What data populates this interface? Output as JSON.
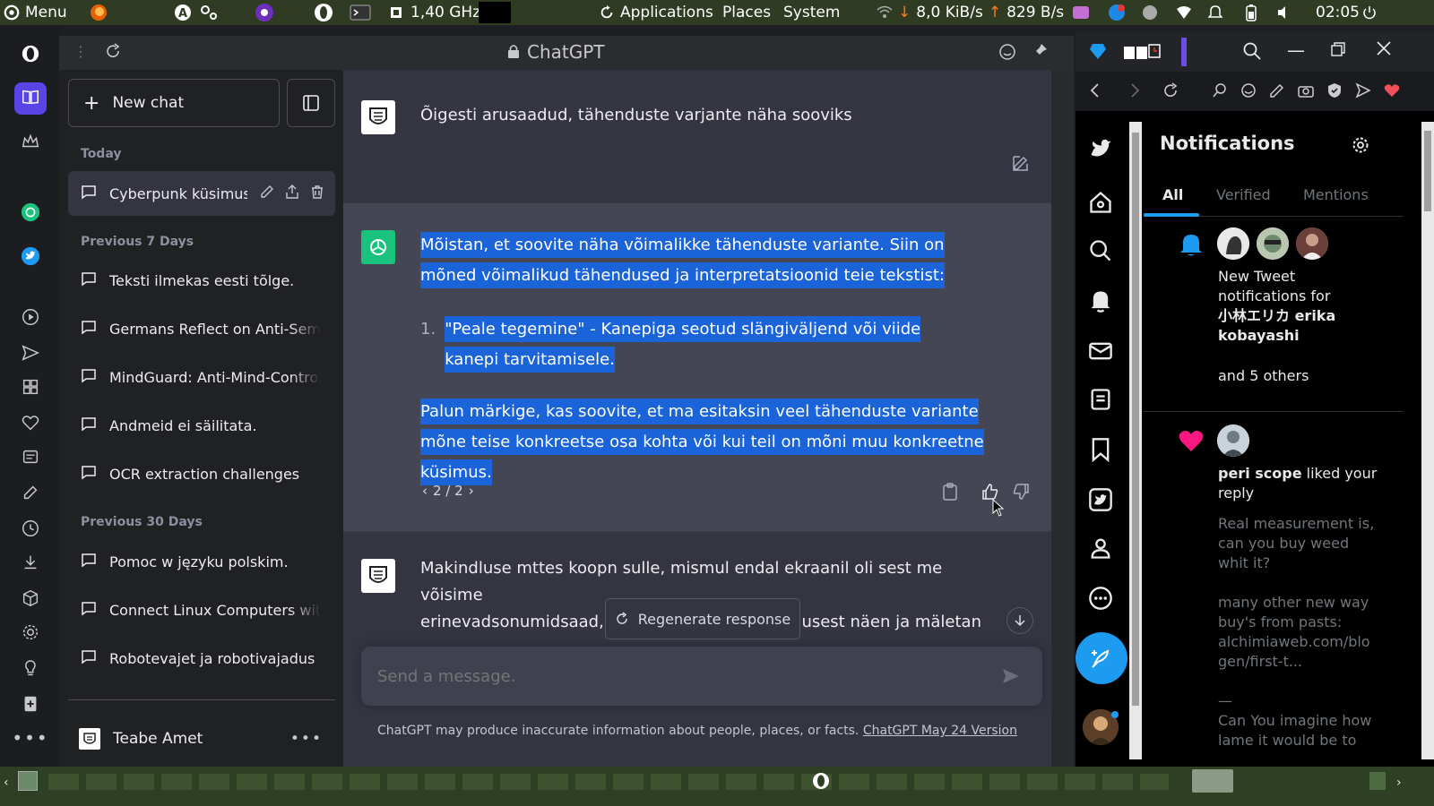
{
  "system_bar": {
    "menu_label": "Menu",
    "cpu_freq": "1,40 GHz",
    "apps_label": "Applications",
    "places_label": "Places",
    "system_label": "System",
    "net_down": "8,0 KiB/s",
    "net_up": "829 B/s",
    "clock": "02:05"
  },
  "browser": {
    "page_title": "ChatGPT"
  },
  "sidebar": {
    "new_chat_label": "New chat",
    "groups": [
      {
        "label": "Today",
        "items": [
          "Cyberpunk küsimused"
        ]
      },
      {
        "label": "Previous 7 Days",
        "items": [
          "Teksti ilmekas eesti tõlge.",
          "Germans Reflect on Anti-Semitism",
          "MindGuard: Anti-Mind-Control",
          "Andmeid ei säilitata.",
          "OCR extraction challenges"
        ]
      },
      {
        "label": "Previous 30 Days",
        "items": [
          "Pomoc w języku polskim.",
          "Connect Linux Computers with",
          "Robotevajet ja robotivajadus"
        ]
      }
    ],
    "user_name": "Teabe Amet"
  },
  "chat": {
    "user_msg_1": "Õigesti arusaadud, tähenduste varjante näha sooviks",
    "bot_para_1": "Mõistan, et soovite näha võimalikke tähenduste variante. Siin on mõned võimalikud tähendused ja interpretatsioonid teie tekstist:",
    "bot_list_num": "1.",
    "bot_list_item": "\"Peale tegemine\" - Kanepiga seotud slängiväljend või viide kanepi tarvitamisele.",
    "bot_para_2": "Palun märkige, kas soovite, et ma esitaksin veel tähenduste variante mõne teise konkreetse osa kohta või kui teil on mõni muu konkreetne küsimus.",
    "pager": "2 / 2",
    "user_msg_2_line1": "Makindluse mttes koopn sulle, mismul endal ekraanil oli sest me võisime",
    "user_msg_2_line2_left": "erinevadsonumidsaad,a",
    "user_msg_2_line2_right": "slusest näen ja mäletan",
    "regenerate_label": "Regenerate response",
    "input_placeholder": "Send a message.",
    "footer_text": "ChatGPT may produce inaccurate information about people, places, or facts.",
    "footer_link": "ChatGPT May 24 Version"
  },
  "twitter": {
    "title": "Notifications",
    "tabs": [
      "All",
      "Verified",
      "Mentions"
    ],
    "notif1_line1": "New Tweet",
    "notif1_line2": "notifications for",
    "notif1_name": "小林エリカ erika",
    "notif1_name2": "kobayashi",
    "notif1_others": "and 5 others",
    "notif2_user": "peri scope",
    "notif2_action": "liked your",
    "notif2_action2": "reply",
    "notif2_quote": [
      "Real measurement is,",
      "can you buy weed",
      "whit it?",
      "",
      "many other new way",
      "buy's from pasts:",
      "alchimiaweb.com/blo",
      "gen/first-t...",
      "",
      "—",
      "Can You imagine how",
      "lame it would be to"
    ]
  },
  "colors": {
    "selection": "#1a63d8",
    "gpt_green": "#19c37d",
    "twitter_blue": "#1d9bf0",
    "like_pink": "#f91880"
  }
}
